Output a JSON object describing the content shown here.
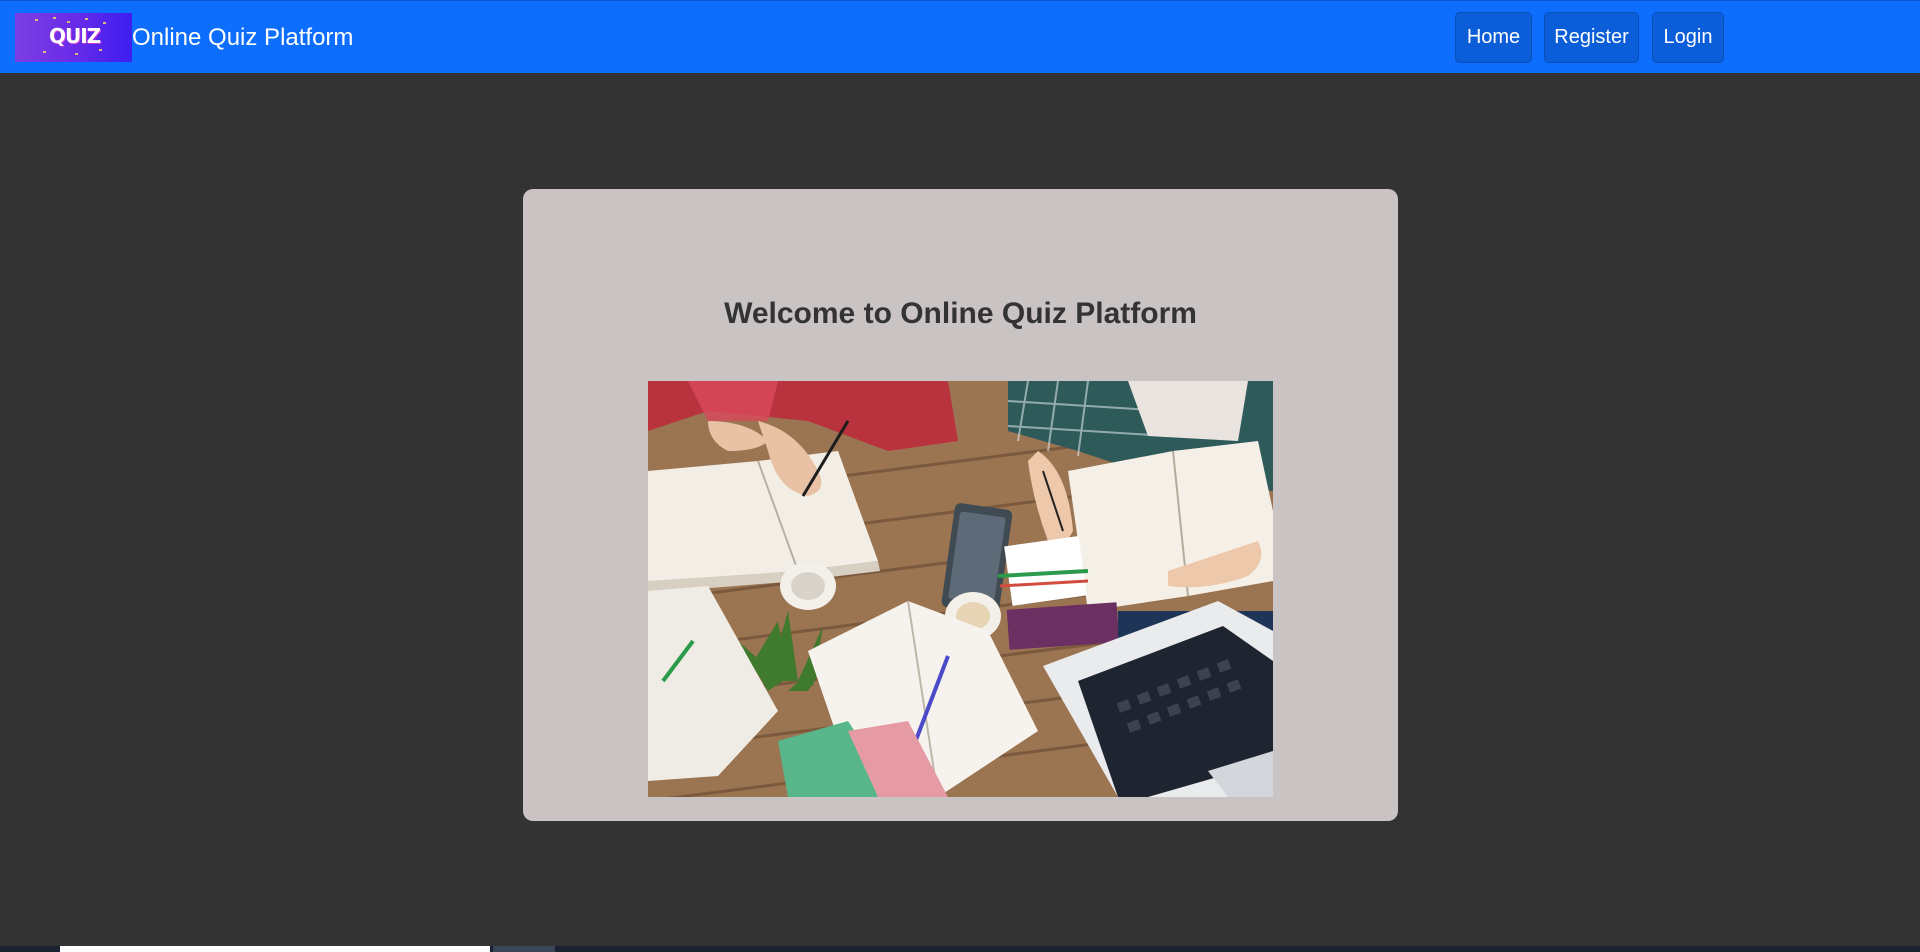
{
  "navbar": {
    "logo_text": "QUIZ",
    "title": "Online Quiz Platform",
    "links": [
      {
        "label": "Home"
      },
      {
        "label": "Register"
      },
      {
        "label": "Login"
      }
    ]
  },
  "main": {
    "heading": "Welcome to Online Quiz Platform"
  },
  "colors": {
    "navbar_bg": "#0d6efd",
    "nav_button_bg": "#0b5ed7",
    "page_bg": "#333333",
    "card_bg": "#c9c3c3",
    "heading_text": "#333333"
  }
}
